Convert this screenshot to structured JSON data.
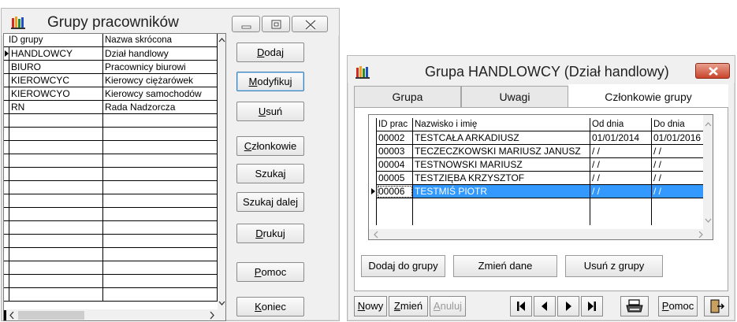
{
  "window1": {
    "title": "Grupy pracowników",
    "columns": [
      "ID grupy",
      "Nazwa skrócona"
    ],
    "rows": [
      {
        "id": "HANDLOWCY",
        "name": "Dział handlowy",
        "current": true
      },
      {
        "id": "BIURO",
        "name": "Pracownicy biurowi",
        "current": false
      },
      {
        "id": "KIEROWCYC",
        "name": "Kierowcy ciężarówek",
        "current": false
      },
      {
        "id": "KIEROWCYO",
        "name": "Kierowcy samochodów",
        "current": false
      },
      {
        "id": "RN",
        "name": "Rada Nadzorcza",
        "current": false
      }
    ],
    "buttons": {
      "dodaj": {
        "u": "D",
        "rest": "odaj"
      },
      "modyfikuj": {
        "u": "M",
        "rest": "odyfikuj"
      },
      "usun": {
        "u": "U",
        "rest": "suń"
      },
      "czlonkowie": {
        "u": "C",
        "rest": "złonkowie"
      },
      "szukaj": "Szukaj",
      "szukaj_dalej": "Szukaj dalej",
      "drukuj": {
        "u": "D",
        "rest": "rukuj"
      },
      "pomoc": {
        "u": "P",
        "rest": "omoc"
      },
      "koniec": {
        "u": "K",
        "rest": "oniec"
      }
    }
  },
  "window2": {
    "title": "Grupa HANDLOWCY (Dział handlowy)",
    "tabs": [
      "Grupa",
      "Uwagi",
      "Członkowie grupy"
    ],
    "active_tab": "Członkowie grupy",
    "columns": [
      "ID prac",
      "Nazwisko i imię",
      "Od dnia",
      "Do dnia"
    ],
    "rows": [
      {
        "id": "00002",
        "name": "TESTCAŁA ARKADIUSZ",
        "from": "01/01/2014",
        "to": "01/01/2016",
        "selected": false
      },
      {
        "id": "00003",
        "name": "TECZECZKOWSKI MARIUSZ JANUSZ",
        "from": "/ /",
        "to": "/ /",
        "selected": false
      },
      {
        "id": "00004",
        "name": "TESTNOWSKI MARIUSZ",
        "from": "/ /",
        "to": "/ /",
        "selected": false
      },
      {
        "id": "00005",
        "name": "TESTZIĘBA KRZYSZTOF",
        "from": "/ /",
        "to": "/ /",
        "selected": false
      },
      {
        "id": "00006",
        "name": "TESTMIŚ PIOTR",
        "from": "/ /",
        "to": "/ /",
        "selected": true
      }
    ],
    "buttons": {
      "dodaj_do_grupy": "Dodaj  do grupy",
      "zmien_dane": "Zmień dane",
      "usun_z_grupy": "Usuń z grupy",
      "nowy": {
        "u": "N",
        "rest": "owy"
      },
      "zmien": {
        "u": "Z",
        "rest": "mień"
      },
      "anuluj": {
        "u": "A",
        "rest": "nuluj"
      },
      "pomoc": {
        "u": "P",
        "rest": "omoc"
      }
    }
  },
  "colors": {
    "selection": "#3399ff",
    "close_button": "#c9462c",
    "window_bg": "#f0f0f0"
  }
}
